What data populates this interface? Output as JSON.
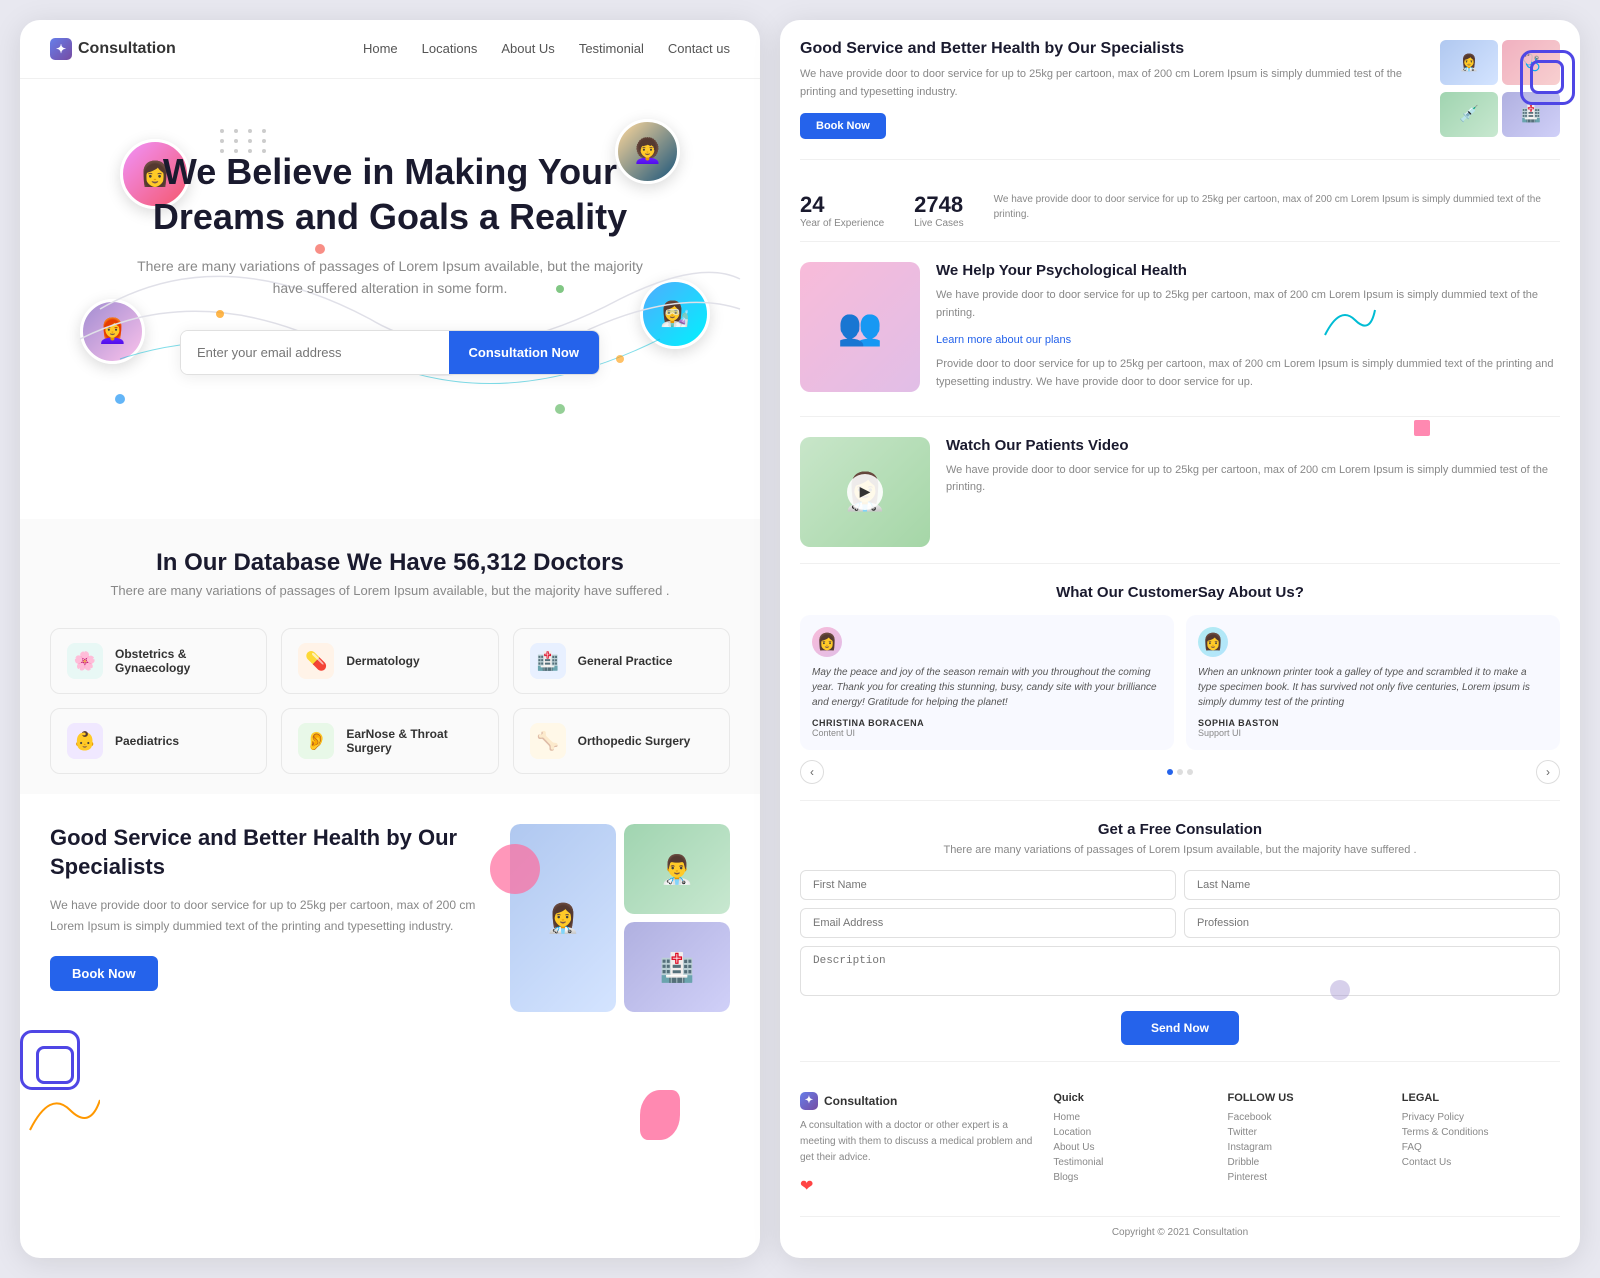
{
  "brand": {
    "name": "Consultation",
    "logo_icon": "✦"
  },
  "nav": {
    "links": [
      "Home",
      "Locations",
      "About Us",
      "Testimonial",
      "Contact us"
    ]
  },
  "hero": {
    "title": "We Believe in Making Your Dreams and Goals a Reality",
    "subtitle": "There are many variations of passages of Lorem Ipsum available,\nbut the majority have suffered alteration in some form.",
    "email_placeholder": "Enter your email address",
    "cta_button": "Consultation Now"
  },
  "stats_section": {
    "heading": "In Our Database We Have 56,312 Doctors",
    "subtitle": "There are many variations of passages of Lorem Ipsum available, but the majority have suffered ."
  },
  "specialties": [
    {
      "name": "Obstetrics & Gynaecology",
      "icon": "🌸",
      "bg": "#e8f8f5"
    },
    {
      "name": "Dermatology",
      "icon": "💊",
      "bg": "#fff3e8"
    },
    {
      "name": "General Practice",
      "icon": "🏥",
      "bg": "#e8f0ff"
    },
    {
      "name": "Paediatrics",
      "icon": "👶",
      "bg": "#f0e8ff"
    },
    {
      "name": "EarNose & Throat Surgery",
      "icon": "👂",
      "bg": "#e8f8e8"
    },
    {
      "name": "Orthopedic Surgery",
      "icon": "🦴",
      "bg": "#fff8e8"
    }
  ],
  "service": {
    "title": "Good Service and Better Health by Our Specialists",
    "description": "We have provide door to door service for up to 25kg per cartoon, max of 200 cm Lorem Ipsum is simply dummied text of the printing and typesetting industry.",
    "book_button": "Book Now"
  },
  "right_service": {
    "title": "Good Service and Better Health by Our Specialists",
    "description": "We have provide door to door service for up to 25kg per cartoon, max of 200 cm Lorem Ipsum is simply dummied test of the printing and typesetting industry.",
    "book_button": "Book Now"
  },
  "stats_right": {
    "years": "24",
    "years_label": "Year of Experience",
    "cases": "2748",
    "cases_label": "Live Cases"
  },
  "psych": {
    "title": "We Help Your Psychological Health",
    "description_1": "We have provide door to door service for up to 25kg per cartoon, max of 200 cm Lorem Ipsum is simply dummied text of the printing.",
    "description_2": "Provide door to door service for up to 25kg per cartoon, max of 200 cm Lorem Ipsum is simply dummied text of the printing and typesetting industry. We have provide door to door service for up.",
    "learn_more": "Learn more about our plans"
  },
  "video": {
    "title": "Watch Our Patients Video",
    "description": "We have provide door to door service for up to 25kg per cartoon, max of 200 cm Lorem Ipsum is simply dummied test of the printing."
  },
  "testimonials": {
    "title": "What Our CustomerSay About Us?",
    "items": [
      {
        "text": "May the peace and joy of the season remain with you throughout the coming year. Thank you for creating this stunning, busy, candy site with your brilliance and energy! Gratitude for helping the planet!",
        "author": "CHRISTINA BORACENA",
        "role": "Content UI"
      },
      {
        "text": "When an unknown printer took a galley of type and scrambled it to make a type specimen book. It has survived not only five centuries, Lorem ipsum is simply dummy test of the printing",
        "author": "SOPHIA BASTON",
        "role": "Support UI"
      }
    ],
    "dots": [
      true,
      false,
      false
    ]
  },
  "consult_form": {
    "title": "Get a Free Consulation",
    "description": "There are many variations of passages of Lorem Ipsum available,\nbut the majority have suffered .",
    "first_name_placeholder": "First Name",
    "last_name_placeholder": "Last Name",
    "email_placeholder": "Email Address",
    "profession_placeholder": "Profession",
    "description_placeholder": "Description",
    "send_button": "Send Now"
  },
  "footer": {
    "brand_name": "Consultation",
    "brand_desc": "A consultation with a doctor or other expert is a meeting with them to discuss a medical problem and get their advice.",
    "quick_title": "Quick",
    "quick_links": [
      "Home",
      "Location",
      "About Us",
      "Testimonial",
      "Blogs"
    ],
    "follow_title": "FOLLOW US",
    "follow_links": [
      "Facebook",
      "Twitter",
      "Instagram",
      "Dribble",
      "Pinterest"
    ],
    "legal_title": "LEGAL",
    "legal_links": [
      "Privacy Policy",
      "Terms & Conditions",
      "FAQ",
      "Contact Us"
    ],
    "copyright": "Copyright © 2021 Consultation"
  }
}
